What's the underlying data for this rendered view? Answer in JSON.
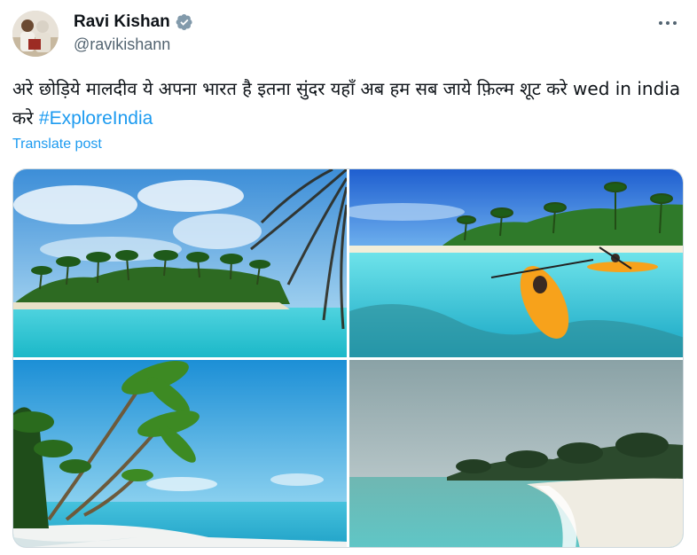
{
  "author": {
    "display_name": "Ravi Kishan",
    "handle": "@ravikishann",
    "verified": true,
    "verified_color": "#829aab"
  },
  "tweet": {
    "text_before": "अरे छोड़िये मालदीव ये अपना भारत है इतना सुंदर यहाँ अब हम सब जाये फ़िल्म शूट करे wed in india करे ",
    "hashtag": "#ExploreIndia",
    "translate_label": "Translate post"
  },
  "icons": {
    "more": "more-horizontal-icon",
    "verified": "verified-badge-icon"
  },
  "colors": {
    "link": "#1d9bf0",
    "text": "#0f1419",
    "secondary": "#536471"
  },
  "media": {
    "count": 4
  }
}
